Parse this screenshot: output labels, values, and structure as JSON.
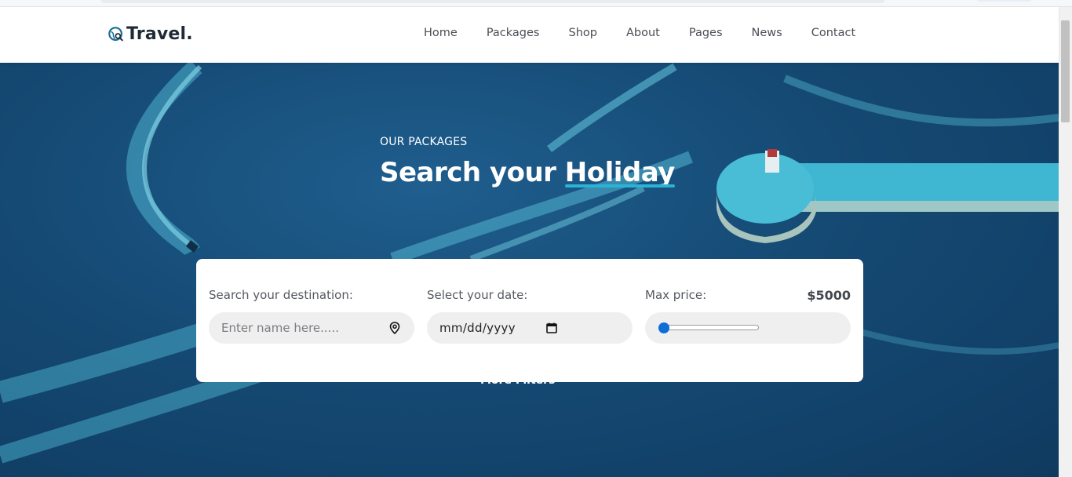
{
  "brand": {
    "name": "Travel."
  },
  "nav": {
    "items": [
      "Home",
      "Packages",
      "Shop",
      "About",
      "Pages",
      "News",
      "Contact"
    ]
  },
  "hero": {
    "eyebrow": "OUR PACKAGES",
    "title_main": "Search your",
    "title_highlight": "Holiday",
    "more_filters": "More Filters"
  },
  "search": {
    "destination": {
      "label": "Search your destination:",
      "placeholder": "Enter name here....."
    },
    "date": {
      "label": "Select your date:",
      "value": "mm/dd/yyyy"
    },
    "price": {
      "label": "Max price:",
      "value": "$5000",
      "level": 0
    }
  },
  "colors": {
    "accent": "#2bb3d6",
    "text_dark": "#1f2a36",
    "slider": "#0f6dd8"
  },
  "icons": {
    "logo": "globe-search-icon",
    "destination": "map-pin-icon",
    "date": "calendar-icon"
  }
}
